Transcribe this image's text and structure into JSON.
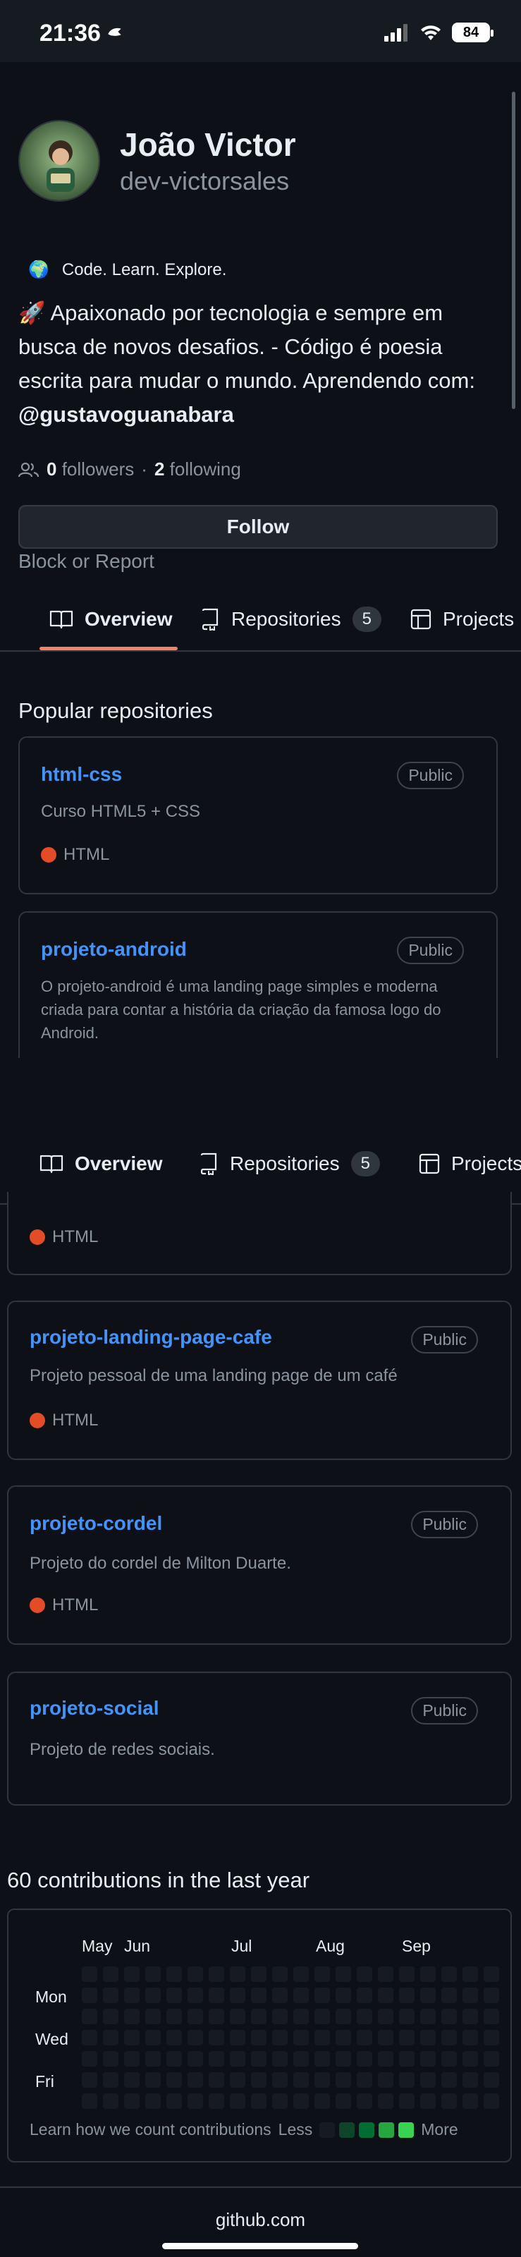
{
  "status_bar": {
    "time": "21:36",
    "battery": "84"
  },
  "profile": {
    "name": "João Victor",
    "login": "dev-victorsales",
    "status_emoji": "🌍",
    "status_text": "Code. Learn. Explore.",
    "bio_text": "🚀 Apaixonado por tecnologia e sempre em busca de novos desafios. - Código é poesia escrita para mudar o mundo. Aprendendo com: ",
    "bio_mention": "@gustavoguanabara",
    "followers_count": "0",
    "followers_label": "followers",
    "separator": "·",
    "following_count": "2",
    "following_label": "following",
    "follow_button": "Follow",
    "block_report": "Block or Report"
  },
  "tabs": [
    {
      "label": "Overview",
      "icon": "book-icon",
      "active": true
    },
    {
      "label": "Repositories",
      "icon": "repo-icon",
      "count": "5"
    },
    {
      "label": "Projects",
      "icon": "table-icon"
    }
  ],
  "tabs_sticky": [
    {
      "label": "Overview"
    },
    {
      "label": "Repositories",
      "count": "5"
    },
    {
      "label": "Projects"
    }
  ],
  "popular": {
    "title": "Popular repositories",
    "repos": [
      {
        "name": "html-css",
        "visibility": "Public",
        "description": "Curso HTML5 + CSS",
        "language": "HTML"
      },
      {
        "name": "projeto-android",
        "visibility": "Public",
        "description": "O projeto-android é uma landing page simples e moderna criada para contar a história da criação da famosa logo do Android."
      },
      {
        "language": "HTML"
      },
      {
        "name": "projeto-landing-page-cafe",
        "visibility": "Public",
        "description": "Projeto pessoal de uma landing page de um café",
        "language": "HTML"
      },
      {
        "name": "projeto-cordel",
        "visibility": "Public",
        "description": "Projeto do cordel de Milton Duarte.",
        "language": "HTML"
      },
      {
        "name": "projeto-social",
        "visibility": "Public",
        "description": "Projeto de redes sociais."
      }
    ]
  },
  "contributions": {
    "title": "60 contributions in the last year",
    "months": [
      "May",
      "Jun",
      "Jul",
      "Aug",
      "Sep"
    ],
    "days": [
      "Mon",
      "Wed",
      "Fri"
    ],
    "learn_link": "Learn how we count contributions",
    "less": "Less",
    "more": "More",
    "legend_colors": [
      "#161b22",
      "#0e4429",
      "#006d32",
      "#26a641",
      "#39d353"
    ]
  },
  "url_bar": {
    "url": "github.com"
  },
  "colors": {
    "accent": "#f78166",
    "link": "#4493f8",
    "html_lang": "#e34c26",
    "background": "#0d1117"
  }
}
